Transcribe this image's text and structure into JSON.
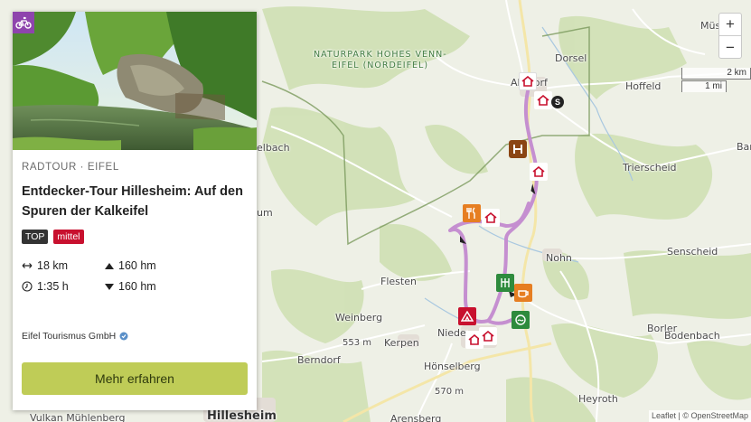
{
  "map": {
    "places": [
      {
        "name": "Müsch",
        "key": "musch"
      },
      {
        "name": "NATURPARK HOHES VENN-",
        "key": "park1"
      },
      {
        "name": "EIFEL (NORDEIFEL)",
        "key": "park2"
      },
      {
        "name": "Dorsel",
        "key": "dorsel"
      },
      {
        "name": "Ahrdorf",
        "key": "ahrdorf"
      },
      {
        "name": "Hoffeld",
        "key": "hoffeld"
      },
      {
        "name": "Bar",
        "key": "bar"
      },
      {
        "name": "Trierscheid",
        "key": "trierscheid"
      },
      {
        "name": "Senscheid",
        "key": "senscheid"
      },
      {
        "name": "Nohn",
        "key": "nohn"
      },
      {
        "name": "Flesten",
        "key": "flesten"
      },
      {
        "name": "Weinberg",
        "key": "weinberg"
      },
      {
        "name": "553 m",
        "key": "h553"
      },
      {
        "name": "Kerpen",
        "key": "kerpen"
      },
      {
        "name": "Niederehe",
        "key": "nieder"
      },
      {
        "name": "Borler",
        "key": "borler"
      },
      {
        "name": "Bodenbach",
        "key": "bodenbach"
      },
      {
        "name": "Berndorf",
        "key": "berndorf"
      },
      {
        "name": "Hönselberg",
        "key": "honselberg"
      },
      {
        "name": "570 m",
        "key": "h570"
      },
      {
        "name": "Heyroth",
        "key": "heyroth"
      },
      {
        "name": "Vulkan Mühlenberg",
        "key": "vulkan"
      },
      {
        "name": "Hillesheim",
        "key": "hillesheim"
      },
      {
        "name": "Arensberg",
        "key": "arensberg"
      },
      {
        "name": "elbach",
        "key": "elbach"
      },
      {
        "name": "um",
        "key": "um"
      }
    ],
    "zoom_in": "+",
    "zoom_out": "−",
    "scale_km": "2 km",
    "scale_mi": "1 mi",
    "attribution": "Leaflet | © OpenStreetMap",
    "route_color": "#c58fd0",
    "park_border_color": "#7a9a5c"
  },
  "card": {
    "category": "RADTOUR · EIFEL",
    "title": "Entdecker-Tour Hillesheim: Auf den Spuren der Kalkeifel",
    "badge_top": "TOP",
    "badge_difficulty": "mittel",
    "distance": "18 km",
    "duration": "1:35 h",
    "ascent": "160 hm",
    "descent": "160 hm",
    "publisher": "Eifel Tourismus GmbH",
    "cta": "Mehr erfahren",
    "activity_icon": "bicycle-icon",
    "accent_color": "#bfcc57"
  }
}
